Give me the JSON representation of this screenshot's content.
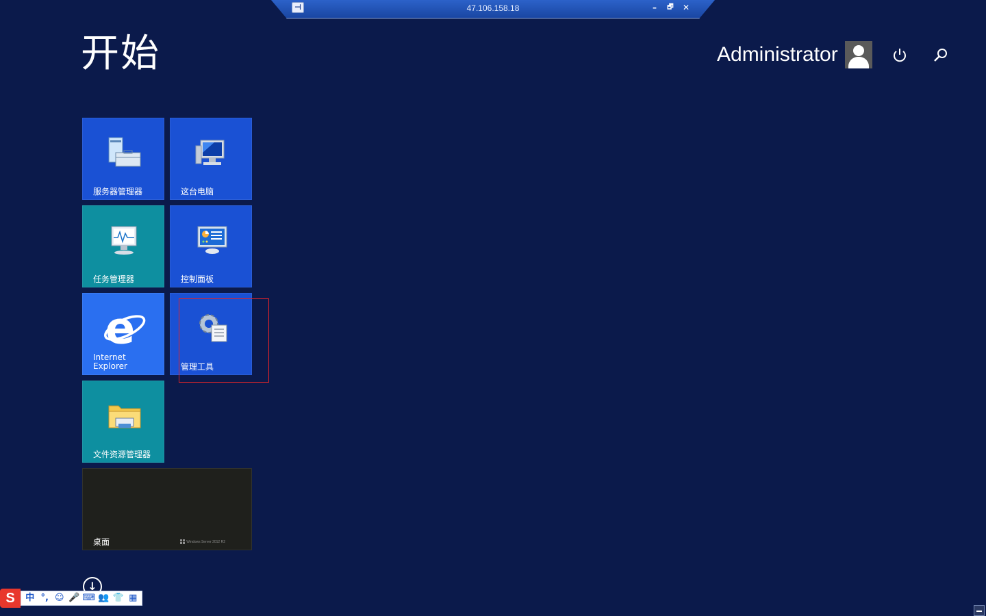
{
  "rdp_bar": {
    "title": "47.106.158.18",
    "pin_glyph": "⊣",
    "minimize_glyph": "–",
    "restore_glyph": "🗗",
    "close_glyph": "✕"
  },
  "header": {
    "title": "开始",
    "user_name": "Administrator",
    "power_icon": "power-icon",
    "search_icon": "search-icon"
  },
  "tiles": [
    {
      "label": "服务器管理器",
      "icon": "server-manager-icon",
      "color": "#1a51d4"
    },
    {
      "label": "这台电脑",
      "icon": "computer-icon",
      "color": "#1a51d4"
    },
    {
      "label": "任务管理器",
      "icon": "task-manager-icon",
      "color": "#0e8fa0"
    },
    {
      "label": "控制面板",
      "icon": "control-panel-icon",
      "color": "#1a51d4"
    },
    {
      "label": "Internet\nExplorer",
      "icon": "internet-explorer-icon",
      "color": "#2a6ff0"
    },
    {
      "label": "管理工具",
      "icon": "administrative-tools-icon",
      "color": "#1a51d4"
    },
    {
      "label": "文件资源管理器",
      "icon": "file-explorer-icon",
      "color": "#0e8fa0"
    },
    {
      "label": "桌面",
      "icon": "desktop-icon",
      "color": "#1f201c"
    }
  ],
  "desktop_badge": "Windows Server 2012 R2",
  "ime_toolbar": {
    "logo": "S",
    "buttons": [
      "中",
      "°,",
      "☺",
      "🎤",
      "⌨",
      "👥",
      "👕",
      "▦"
    ]
  },
  "colors": {
    "background": "#0b1a4b",
    "tile_blue": "#1a51d4",
    "tile_teal": "#0e8fa0",
    "selection": "#e0242a"
  }
}
